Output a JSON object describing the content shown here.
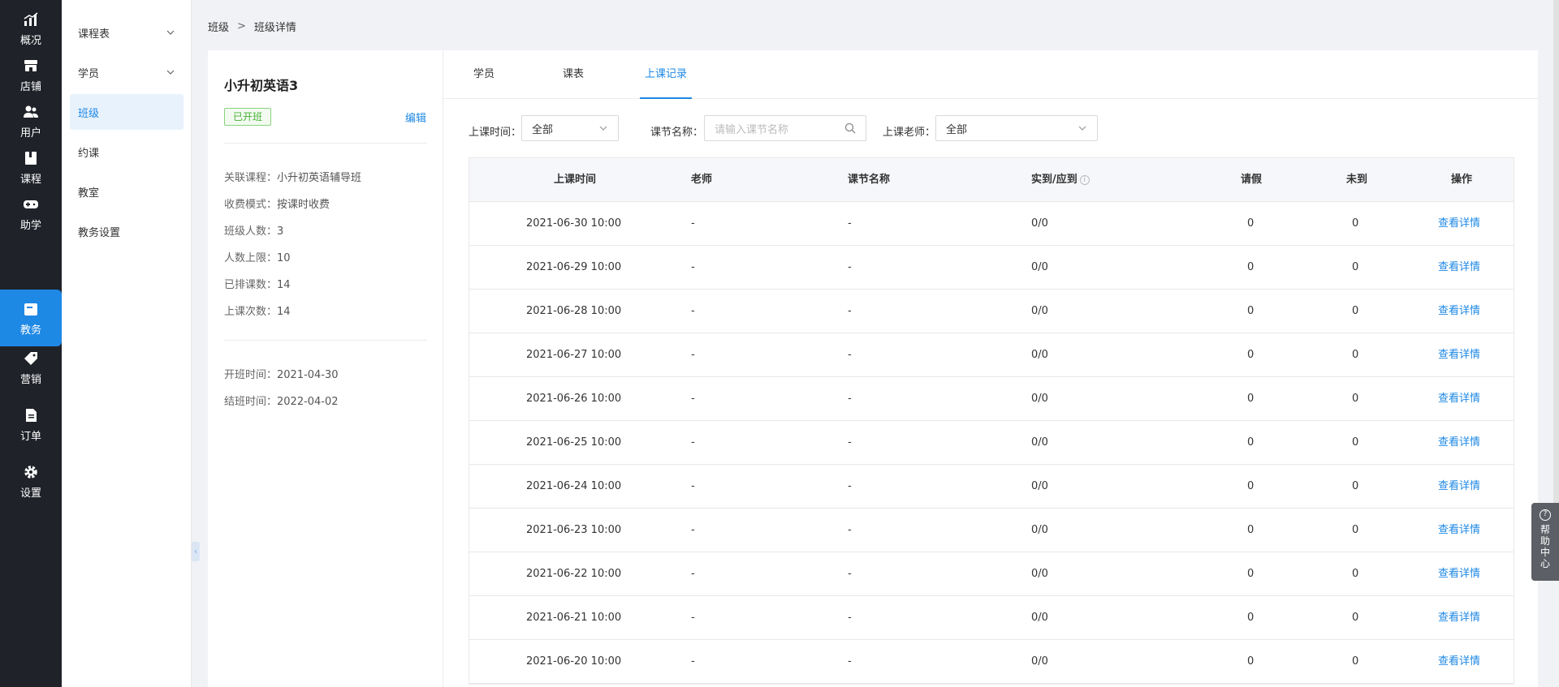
{
  "nav": {
    "items": [
      {
        "label": "概况",
        "icon": "chart-icon"
      },
      {
        "label": "店铺",
        "icon": "store-icon"
      },
      {
        "label": "用户",
        "icon": "users-icon"
      },
      {
        "label": "课程",
        "icon": "book-icon"
      },
      {
        "label": "助学",
        "icon": "gamepad-icon"
      },
      {
        "label": "教务",
        "icon": "calendar-icon"
      },
      {
        "label": "营销",
        "icon": "tag-icon"
      },
      {
        "label": "订单",
        "icon": "document-icon"
      },
      {
        "label": "设置",
        "icon": "gear-icon"
      }
    ],
    "active": "教务"
  },
  "submenu": {
    "items": [
      {
        "label": "课程表"
      },
      {
        "label": "学员"
      },
      {
        "label": "班级"
      },
      {
        "label": "约课"
      },
      {
        "label": "教室"
      },
      {
        "label": "教务设置"
      }
    ]
  },
  "breadcrumb": {
    "parent": "班级",
    "separator": ">",
    "current": "班级详情"
  },
  "class_info": {
    "title": "小升初英语3",
    "status": "已开班",
    "edit_label": "编辑",
    "rows": [
      {
        "key": "关联课程：",
        "value": "小升初英语辅导班"
      },
      {
        "key": "收费模式：",
        "value": "按课时收费"
      },
      {
        "key": "班级人数：",
        "value": "3"
      },
      {
        "key": "人数上限：",
        "value": "10"
      },
      {
        "key": "已排课数：",
        "value": "14"
      },
      {
        "key": "上课次数：",
        "value": "14"
      }
    ],
    "dates": [
      {
        "key": "开班时间：",
        "value": "2021-04-30"
      },
      {
        "key": "结班时间：",
        "value": "2022-04-02"
      }
    ]
  },
  "tabs": [
    {
      "label": "学员"
    },
    {
      "label": "课表"
    },
    {
      "label": "上课记录"
    }
  ],
  "active_tab": "上课记录",
  "filters": {
    "time_label": "上课时间：",
    "time_value": "全部",
    "name_label": "课节名称：",
    "name_placeholder": "请输入课节名称",
    "teacher_label": "上课老师：",
    "teacher_value": "全部"
  },
  "table": {
    "columns": [
      "上课时间",
      "老师",
      "课节名称",
      "实到/应到",
      "请假",
      "未到",
      "操作"
    ],
    "rows": [
      [
        "2021-06-30 10:00",
        "-",
        "-",
        "0/0",
        "0",
        "0",
        "查看详情"
      ],
      [
        "2021-06-29 10:00",
        "-",
        "-",
        "0/0",
        "0",
        "0",
        "查看详情"
      ],
      [
        "2021-06-28 10:00",
        "-",
        "-",
        "0/0",
        "0",
        "0",
        "查看详情"
      ],
      [
        "2021-06-27 10:00",
        "-",
        "-",
        "0/0",
        "0",
        "0",
        "查看详情"
      ],
      [
        "2021-06-26 10:00",
        "-",
        "-",
        "0/0",
        "0",
        "0",
        "查看详情"
      ],
      [
        "2021-06-25 10:00",
        "-",
        "-",
        "0/0",
        "0",
        "0",
        "查看详情"
      ],
      [
        "2021-06-24 10:00",
        "-",
        "-",
        "0/0",
        "0",
        "0",
        "查看详情"
      ],
      [
        "2021-06-23 10:00",
        "-",
        "-",
        "0/0",
        "0",
        "0",
        "查看详情"
      ],
      [
        "2021-06-22 10:00",
        "-",
        "-",
        "0/0",
        "0",
        "0",
        "查看详情"
      ],
      [
        "2021-06-21 10:00",
        "-",
        "-",
        "0/0",
        "0",
        "0",
        "查看详情"
      ],
      [
        "2021-06-20 10:00",
        "-",
        "-",
        "0/0",
        "0",
        "0",
        "查看详情"
      ]
    ]
  },
  "help": {
    "label": "帮助中心"
  },
  "colors": {
    "accent": "#1e88e5",
    "nav_bg": "#1f2229",
    "status_green": "#47b034"
  }
}
